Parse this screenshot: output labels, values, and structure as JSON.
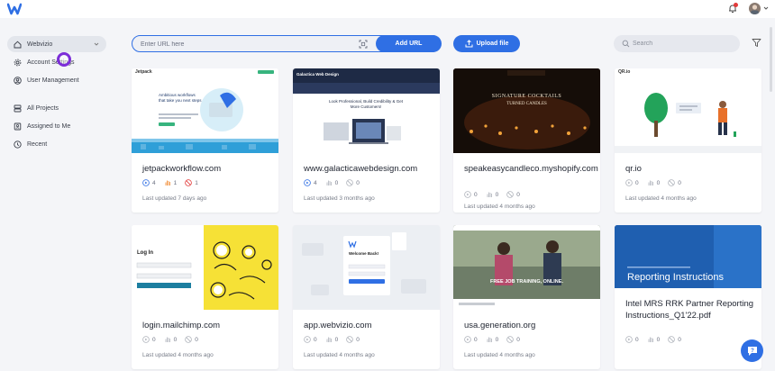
{
  "header": {
    "logo_icon": "webvizio-logo",
    "bell_icon": "bell-icon",
    "avatar_icon": "user-avatar"
  },
  "sidebar": {
    "workspace": "Webvizio",
    "items": [
      {
        "label": "Account Settings",
        "icon": "gear-icon"
      },
      {
        "label": "User Management",
        "icon": "user-icon"
      },
      {
        "label": "All Projects",
        "icon": "stack-icon"
      },
      {
        "label": "Assigned to Me",
        "icon": "assigned-icon"
      },
      {
        "label": "Recent",
        "icon": "clock-icon"
      }
    ]
  },
  "toolbar": {
    "url_placeholder": "Enter URL here",
    "add_url_label": "Add URL",
    "upload_label": "Upload file",
    "search_placeholder": "Search"
  },
  "cards": [
    {
      "title": "jetpackworkflow.com",
      "open": "4",
      "in_progress": "1",
      "rejected": "1",
      "updated": "Last updated 7 days ago"
    },
    {
      "title": "www.galacticawebdesign.com",
      "open": "4",
      "in_progress": "0",
      "rejected": "0",
      "updated": "Last updated 3 months ago"
    },
    {
      "title": "speakeasycandleco.myshopify.com",
      "open": "0",
      "in_progress": "0",
      "rejected": "0",
      "updated": "Last updated 4 months ago"
    },
    {
      "title": "qr.io",
      "open": "0",
      "in_progress": "0",
      "rejected": "0",
      "updated": "Last updated 4 months ago"
    },
    {
      "title": "login.mailchimp.com",
      "open": "0",
      "in_progress": "0",
      "rejected": "0",
      "updated": "Last updated 4 months ago"
    },
    {
      "title": "app.webvizio.com",
      "open": "0",
      "in_progress": "0",
      "rejected": "0",
      "updated": "Last updated 4 months ago"
    },
    {
      "title": "usa.generation.org",
      "open": "0",
      "in_progress": "0",
      "rejected": "0",
      "updated": "Last updated 4 months ago"
    },
    {
      "title": "Intel MRS RRK Partner Reporting Instructions_Q1'22.pdf",
      "open": "0",
      "in_progress": "0",
      "rejected": "0",
      "updated": ""
    }
  ],
  "thumbs": {
    "jetpack_brand": "Jetpack",
    "jetpack_headline": "Ambitious workflows that take you next steps",
    "galactica_brand": "Galactica Web Design",
    "galactica_headline": "Look Professional, Build Credibility & Get More Customers!",
    "candle_line1": "SIGNATURE COCKTAILS",
    "candle_line2": "TURNED CANDLES",
    "qr_brand": "QR.io",
    "mailchimp_title": "Log In",
    "webvizio_title": "Welcome Back!",
    "generation_text": "FREE JOB TRAINING, ONLINE.",
    "intel_text": "Reporting Instructions"
  },
  "colors": {
    "accent": "#2f6fe4",
    "cursor": "#7c2ed8",
    "open": "#2f6fe4",
    "in_progress": "#f0862a",
    "rejected": "#e23b3b"
  }
}
